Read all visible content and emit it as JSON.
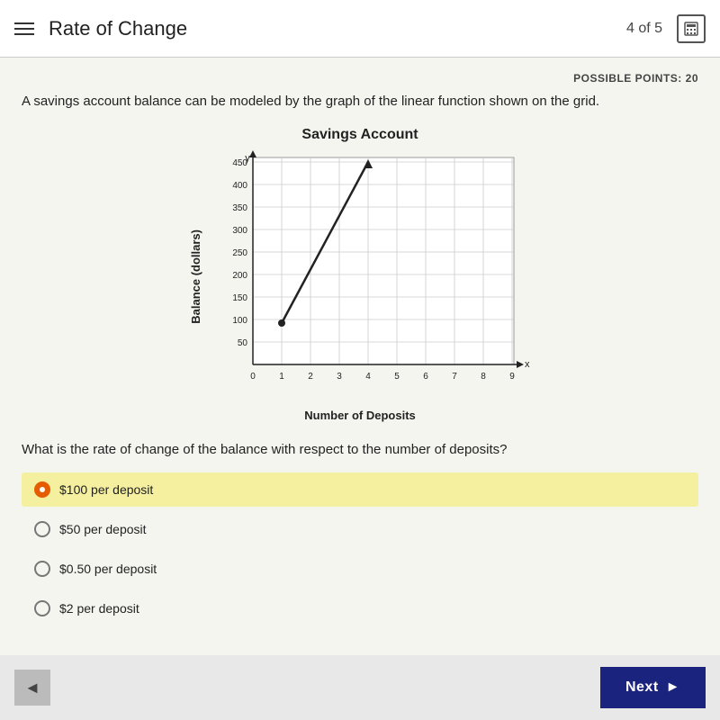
{
  "header": {
    "title": "Rate of Change",
    "progress": "4 of 5",
    "hamburger_label": "menu",
    "calculator_label": "calculator"
  },
  "content": {
    "points_label": "POSSIBLE POINTS: 20",
    "question_text": "A savings account balance can be modeled by the graph of the linear function shown on the grid.",
    "chart": {
      "title": "Savings Account",
      "y_axis_label": "Balance (dollars)",
      "x_axis_label": "Number of Deposits",
      "y_values": [
        50,
        100,
        150,
        200,
        250,
        300,
        350,
        400,
        450
      ],
      "x_values": [
        0,
        1,
        2,
        3,
        4,
        5,
        6,
        7,
        8,
        9
      ]
    },
    "sub_question": "What is the rate of change of the balance with respect to the number of deposits?",
    "options": [
      {
        "id": "opt1",
        "label": "$100 per deposit",
        "selected": true
      },
      {
        "id": "opt2",
        "label": "$50 per deposit",
        "selected": false
      },
      {
        "id": "opt3",
        "label": "$0.50 per deposit",
        "selected": false
      },
      {
        "id": "opt4",
        "label": "$2 per deposit",
        "selected": false
      }
    ]
  },
  "footer": {
    "back_label": "◄",
    "next_label": "Next",
    "next_arrow": "►"
  }
}
